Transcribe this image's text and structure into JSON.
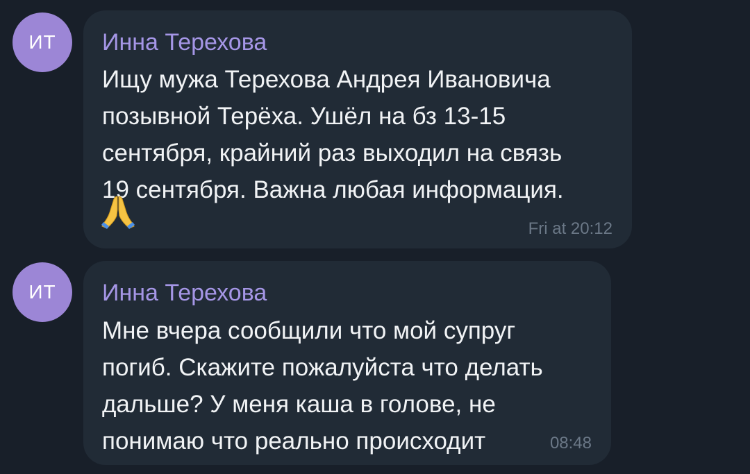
{
  "messages": [
    {
      "avatar_initials": "ИТ",
      "sender": "Инна Терехова",
      "lines": [
        "Ищу мужа Терехова Андрея Ивановича",
        "позывной Терёха. Ушёл на бз 13-15",
        "сентября, крайний раз выходил на связь",
        "19 сентября. Важна любая информация."
      ],
      "emoji": "folded-hands-emoji",
      "time": "Fri at 20:12"
    },
    {
      "avatar_initials": "ИТ",
      "sender": "Инна Терехова",
      "lines": [
        "Мне вчера сообщили что мой супруг",
        "погиб. Скажите пожалуйста что делать",
        "дальше? У меня каша в голове, не",
        "понимаю что реально происходит"
      ],
      "time": "08:48"
    }
  ],
  "colors": {
    "background": "#181f29",
    "bubble": "#212b36",
    "avatar": "#9c86d6",
    "sender_name": "#a596e6",
    "message_text": "#f1f3f5",
    "timestamp": "#6b7887"
  }
}
